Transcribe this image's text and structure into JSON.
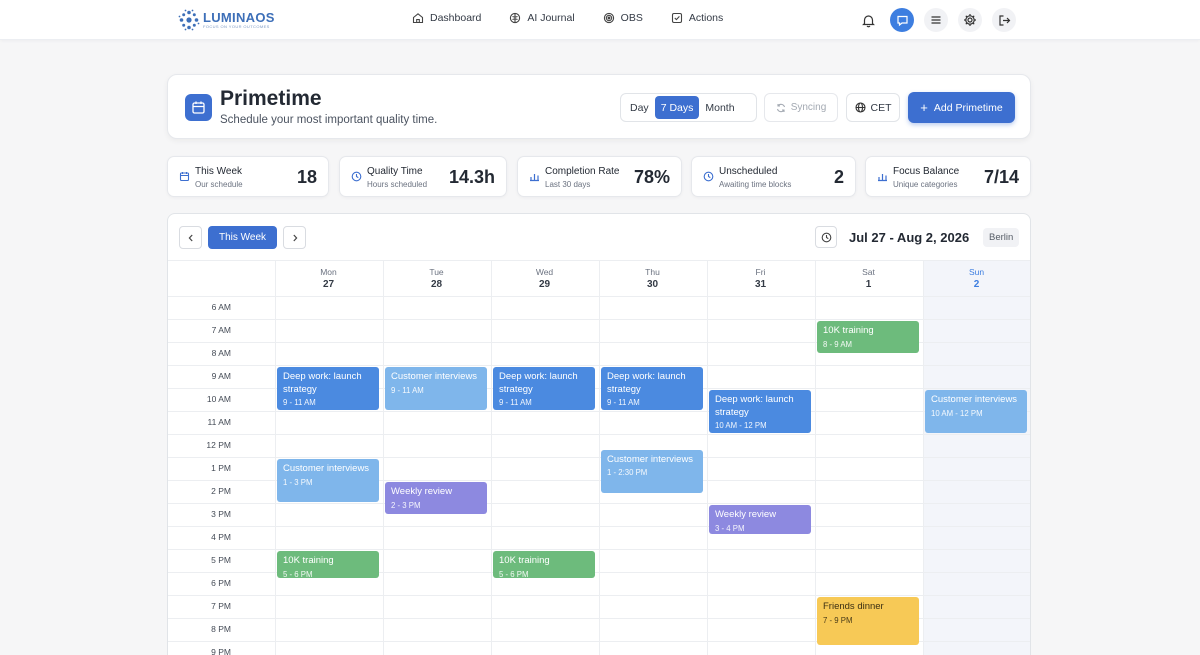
{
  "nav": {
    "logo_name": "LUMINAOS",
    "logo_tagline": "FOCUS ON YOUR OUTCOMES",
    "links": [
      {
        "label": "Dashboard",
        "icon": "home-icon"
      },
      {
        "label": "AI Journal",
        "icon": "brain-icon"
      },
      {
        "label": "OBS",
        "icon": "target-icon"
      },
      {
        "label": "Actions",
        "icon": "checkbox-icon"
      }
    ],
    "right_icons": [
      "bell-icon",
      "chat-icon",
      "menu-icon",
      "gear-icon",
      "logout-icon"
    ]
  },
  "header": {
    "title": "Primetime",
    "subtitle": "Schedule your most important quality time.",
    "views": [
      "Day",
      "7 Days",
      "Month"
    ],
    "active_view": "7 Days",
    "sync_label": "Syncing",
    "timezone_label": "CET",
    "add_label": "Add Primetime"
  },
  "stats": [
    {
      "label": "This Week",
      "sub": "Our schedule",
      "value": "18",
      "icon": "calendar-icon"
    },
    {
      "label": "Quality Time",
      "sub": "Hours scheduled",
      "value": "14.3h",
      "icon": "clock-icon"
    },
    {
      "label": "Completion Rate",
      "sub": "Last 30 days",
      "value": "78%",
      "icon": "bar-chart-icon"
    },
    {
      "label": "Unscheduled",
      "sub": "Awaiting time blocks",
      "value": "2",
      "icon": "clock-icon"
    },
    {
      "label": "Focus Balance",
      "sub": "Unique categories",
      "value": "7/14",
      "icon": "bar-chart-icon"
    }
  ],
  "calendar": {
    "this_week_label": "This Week",
    "date_range": "Jul 27 - Aug 2, 2026",
    "city": "Berlin",
    "days": [
      {
        "name": "Mon",
        "num": "27"
      },
      {
        "name": "Tue",
        "num": "28"
      },
      {
        "name": "Wed",
        "num": "29"
      },
      {
        "name": "Thu",
        "num": "30"
      },
      {
        "name": "Fri",
        "num": "31"
      },
      {
        "name": "Sat",
        "num": "1"
      },
      {
        "name": "Sun",
        "num": "2",
        "today": true
      }
    ],
    "hours": [
      "6 AM",
      "7 AM",
      "8 AM",
      "9 AM",
      "10 AM",
      "11 AM",
      "12 PM",
      "1 PM",
      "2 PM",
      "3 PM",
      "4 PM",
      "5 PM",
      "6 PM",
      "7 PM",
      "8 PM",
      "9 PM"
    ],
    "events": [
      {
        "day": 0,
        "start": 9,
        "end": 11,
        "title": "Deep work: launch strategy",
        "time": "9 - 11 AM",
        "kind": "deep",
        "color": "#4b8ae0"
      },
      {
        "day": 1,
        "start": 9,
        "end": 11,
        "title": "Customer interviews",
        "time": "9 - 11 AM",
        "kind": "cust",
        "color": "#7fb6eb"
      },
      {
        "day": 2,
        "start": 9,
        "end": 11,
        "title": "Deep work: launch strategy",
        "time": "9 - 11 AM",
        "kind": "deep",
        "color": "#4b8ae0"
      },
      {
        "day": 3,
        "start": 9,
        "end": 11,
        "title": "Deep work: launch strategy",
        "time": "9 - 11 AM",
        "kind": "deep",
        "color": "#4b8ae0"
      },
      {
        "day": 4,
        "start": 10,
        "end": 12,
        "title": "Deep work: launch strategy",
        "time": "10 AM - 12 PM",
        "kind": "deep",
        "color": "#4b8ae0"
      },
      {
        "day": 6,
        "start": 10,
        "end": 12,
        "title": "Customer interviews",
        "time": "10 AM - 12 PM",
        "kind": "cust",
        "color": "#7fb6eb"
      },
      {
        "day": 5,
        "start": 7,
        "end": 8.5,
        "title": "10K training",
        "time": "8 - 9 AM",
        "kind": "train",
        "color": "#6dbb7c"
      },
      {
        "day": 0,
        "start": 13,
        "end": 15,
        "title": "Customer interviews",
        "time": "1 - 3 PM",
        "kind": "cust",
        "color": "#7fb6eb"
      },
      {
        "day": 1,
        "start": 14,
        "end": 15.5,
        "title": "Weekly review",
        "time": "2 - 3 PM",
        "kind": "review",
        "color": "#8d89e0"
      },
      {
        "day": 3,
        "start": 12.6,
        "end": 14.6,
        "title": "Customer interviews",
        "time": "1 - 2:30 PM",
        "kind": "cust",
        "color": "#7fb6eb"
      },
      {
        "day": 4,
        "start": 15,
        "end": 16.4,
        "title": "Weekly review",
        "time": "3 - 4 PM",
        "kind": "review",
        "color": "#8d89e0"
      },
      {
        "day": 0,
        "start": 17,
        "end": 18.3,
        "title": "10K training",
        "time": "5 - 6 PM",
        "kind": "train",
        "color": "#6dbb7c"
      },
      {
        "day": 2,
        "start": 17,
        "end": 18.3,
        "title": "10K training",
        "time": "5 - 6 PM",
        "kind": "train",
        "color": "#6dbb7c"
      },
      {
        "day": 5,
        "start": 19,
        "end": 21.2,
        "title": "Friends dinner",
        "time": "7 - 9 PM",
        "kind": "dinner",
        "color": "#f7c956"
      }
    ]
  }
}
